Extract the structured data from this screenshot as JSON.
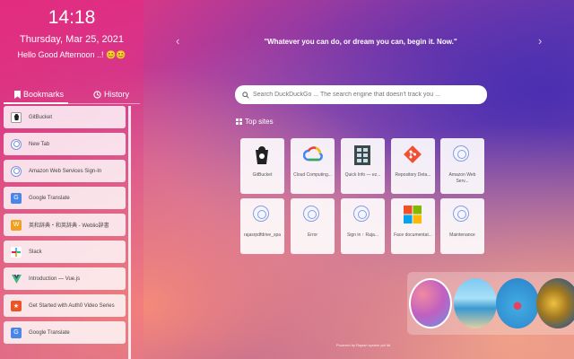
{
  "sidebar": {
    "time": "14:18",
    "date": "Thursday, Mar 25, 2021",
    "greeting": "Hello Good Afternoon ..! 😊😊",
    "tabs": {
      "bookmarks": "Bookmarks",
      "history": "History"
    },
    "bookmarks": [
      {
        "label": "GitBucket",
        "icon": "gitbucket-icon"
      },
      {
        "label": "New Tab",
        "icon": "globe-icon"
      },
      {
        "label": "Amazon Web Services Sign-In",
        "icon": "globe-icon"
      },
      {
        "label": "Google Translate",
        "icon": "google-translate-icon"
      },
      {
        "label": "英和辞典・和英辞典 - Weblio辞書",
        "icon": "weblio-icon"
      },
      {
        "label": "Slack",
        "icon": "slack-icon"
      },
      {
        "label": "Introduction — Vue.js",
        "icon": "vue-icon"
      },
      {
        "label": "Get Started with Auth0 Video Series",
        "icon": "auth0-icon"
      },
      {
        "label": "Google Translate",
        "icon": "google-translate-icon"
      }
    ]
  },
  "quote": "\"Whatever you can do, or dream you can, begin it. Now.\"",
  "search": {
    "placeholder": "Search DuckDuckGo ... The search engine that doesn't track you ..."
  },
  "top_sites": {
    "label": "Top sites",
    "items": [
      {
        "label": "GitBucket",
        "icon": "gitbucket-icon"
      },
      {
        "label": "Cloud Computing...",
        "icon": "google-cloud-icon"
      },
      {
        "label": "Quick Info — ez...",
        "icon": "quick-info-icon"
      },
      {
        "label": "Repository Deta...",
        "icon": "git-icon"
      },
      {
        "label": "Amazon Web Serv...",
        "icon": "globe-icon"
      },
      {
        "label": "rajasrpdfdrive_spa",
        "icon": "globe-icon"
      },
      {
        "label": "Error",
        "icon": "globe-icon"
      },
      {
        "label": "Sign in ↑ Raja...",
        "icon": "globe-icon"
      },
      {
        "label": "Face documentat...",
        "icon": "microsoft-icon"
      },
      {
        "label": "Maintenance",
        "icon": "globe-icon"
      }
    ]
  },
  "footer": "Powered by Rajasri system pvt ltd",
  "colors": {
    "accent": "#e0307a",
    "sidebar_text": "#444444"
  }
}
